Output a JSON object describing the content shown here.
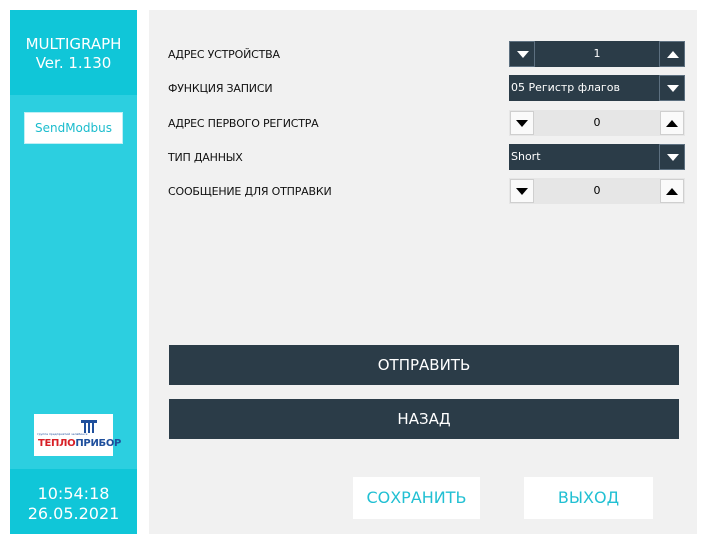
{
  "sidebar": {
    "app_name": "MULTIGRAPH",
    "version": "Ver. 1.130",
    "nav_button": "SendModbus",
    "logo": {
      "small_text": "группа предприятий челябинск",
      "brand_red": "ТЕПЛО",
      "brand_blue": "ПРИБОР"
    },
    "time": "10:54:18",
    "date": "26.05.2021"
  },
  "form": {
    "device_address": {
      "label": "АДРЕС УСТРОЙСТВА",
      "value": "1"
    },
    "write_function": {
      "label": "ФУНКЦИЯ ЗАПИСИ",
      "value": "05 Регистр флагов"
    },
    "first_register": {
      "label": "АДРЕС ПЕРВОГО РЕГИСТРА",
      "value": "0"
    },
    "data_type": {
      "label": "ТИП ДАННЫХ",
      "value": "Short"
    },
    "message": {
      "label": "СООБЩЕНИЕ ДЛЯ ОТПРАВКИ",
      "value": "0"
    }
  },
  "actions": {
    "send": "ОТПРАВИТЬ",
    "back": "НАЗАД",
    "save": "СОХРАНИТЬ",
    "exit": "ВЫХОД"
  },
  "colors": {
    "sidebar": "#2ccfe0",
    "sidebar_dark": "#10c6d8",
    "panel": "#f1f1f1",
    "dark_control": "#2b3c48",
    "accent_text": "#22c0d3"
  },
  "icons": {
    "decrement": "triangle-down-icon",
    "increment": "triangle-up-icon",
    "dropdown": "chevron-down-icon"
  }
}
